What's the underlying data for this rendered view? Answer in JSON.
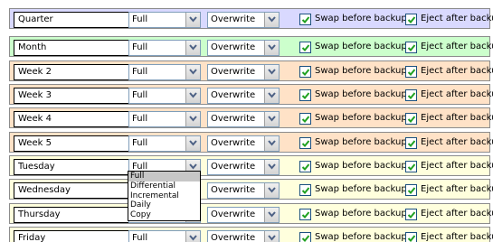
{
  "rows": [
    {
      "name": "Quarter",
      "type": "Full",
      "mode": "Overwrite",
      "swap_label": "Swap before backup",
      "eject_label": "Eject after backup",
      "bg": "#d9d9ff"
    },
    {
      "name": "Month",
      "type": "Full",
      "mode": "Overwrite",
      "swap_label": "Swap before backup",
      "eject_label": "Eject after backup",
      "bg": "#ccffcc"
    },
    {
      "name": "Week 2",
      "type": "Full",
      "mode": "Overwrite",
      "swap_label": "Swap before backup",
      "eject_label": "Eject after backup",
      "bg": "#ffe2c7"
    },
    {
      "name": "Week 3",
      "type": "Full",
      "mode": "Overwrite",
      "swap_label": "Swap before backup",
      "eject_label": "Eject after backup",
      "bg": "#ffe2c7"
    },
    {
      "name": "Week 4",
      "type": "Full",
      "mode": "Overwrite",
      "swap_label": "Swap before backup",
      "eject_label": "Eject after backup",
      "bg": "#ffe2c7"
    },
    {
      "name": "Week 5",
      "type": "Full",
      "mode": "Overwrite",
      "swap_label": "Swap before backup",
      "eject_label": "Eject after backup",
      "bg": "#ffe2c7"
    },
    {
      "name": "Tuesday",
      "type": "Full",
      "mode": "Overwrite",
      "swap_label": "Swap before backup",
      "eject_label": "Eject after backup",
      "bg": "#ffffdd"
    },
    {
      "name": "Wednesday",
      "type": "Full",
      "mode": "Overwrite",
      "swap_label": "Swap before backup",
      "eject_label": "Eject after backup",
      "bg": "#ffffdd"
    },
    {
      "name": "Thursday",
      "type": "Full",
      "mode": "Overwrite",
      "swap_label": "Swap before backup",
      "eject_label": "Eject after backup",
      "bg": "#ffffdd"
    },
    {
      "name": "Friday",
      "type": "Full",
      "mode": "Overwrite",
      "swap_label": "Swap before backup",
      "eject_label": "Eject after backup",
      "bg": "#ffffdd"
    }
  ],
  "swap_checked": true,
  "eject_checked": true,
  "open_dropdown": {
    "row": "Tuesday",
    "options": [
      "Full",
      "Differential",
      "Incremental",
      "Daily",
      "Copy"
    ],
    "highlighted": "Full"
  },
  "icons": {
    "combo_arrow": "chevron-down-icon",
    "checkbox_mark": "check-icon"
  },
  "colors": {
    "checkbox_border": "#1c5180",
    "check_mark": "#21a121",
    "combo_border": "#7f9db9"
  }
}
